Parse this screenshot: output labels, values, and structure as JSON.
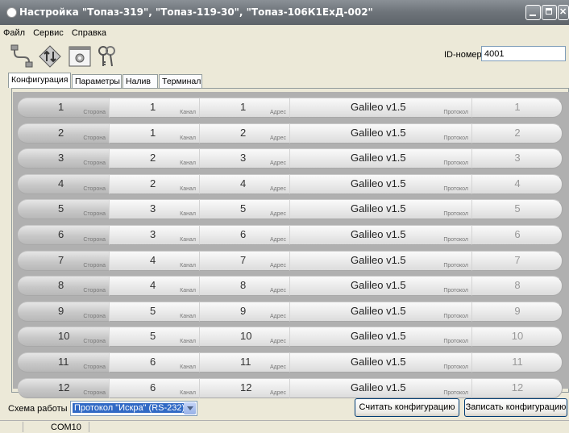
{
  "window": {
    "title": "Настройка \"Топаз-319\", \"Топаз-119-30\", \"Топаз-106К1ЕхД-002\""
  },
  "menu": {
    "items": [
      "Файл",
      "Сервис",
      "Справка"
    ]
  },
  "toolbar": {
    "icons": [
      "connect-cable-icon",
      "transfer-arrows-icon",
      "settings-icon",
      "keys-icon"
    ]
  },
  "id": {
    "label": "ID-номер",
    "value": "4001"
  },
  "tabs": [
    "Конфигурация",
    "Параметры",
    "Налив",
    "Терминал"
  ],
  "grid": {
    "sub_labels": {
      "side": "Сторона",
      "channel": "Канал",
      "address": "Адрес",
      "protocol": "Протокол"
    },
    "rows": [
      {
        "side": "1",
        "channel": "1",
        "address": "1",
        "protocol": "Galileo v1.5",
        "extra": "1"
      },
      {
        "side": "2",
        "channel": "1",
        "address": "2",
        "protocol": "Galileo v1.5",
        "extra": "2"
      },
      {
        "side": "3",
        "channel": "2",
        "address": "3",
        "protocol": "Galileo v1.5",
        "extra": "3"
      },
      {
        "side": "4",
        "channel": "2",
        "address": "4",
        "protocol": "Galileo v1.5",
        "extra": "4"
      },
      {
        "side": "5",
        "channel": "3",
        "address": "5",
        "protocol": "Galileo v1.5",
        "extra": "5"
      },
      {
        "side": "6",
        "channel": "3",
        "address": "6",
        "protocol": "Galileo v1.5",
        "extra": "6"
      },
      {
        "side": "7",
        "channel": "4",
        "address": "7",
        "protocol": "Galileo v1.5",
        "extra": "7"
      },
      {
        "side": "8",
        "channel": "4",
        "address": "8",
        "protocol": "Galileo v1.5",
        "extra": "8"
      },
      {
        "side": "9",
        "channel": "5",
        "address": "9",
        "protocol": "Galileo v1.5",
        "extra": "9"
      },
      {
        "side": "10",
        "channel": "5",
        "address": "10",
        "protocol": "Galileo v1.5",
        "extra": "10"
      },
      {
        "side": "11",
        "channel": "6",
        "address": "11",
        "protocol": "Galileo v1.5",
        "extra": "11"
      },
      {
        "side": "12",
        "channel": "6",
        "address": "12",
        "protocol": "Galileo v1.5",
        "extra": "12"
      }
    ]
  },
  "bottom": {
    "mode_label": "Схема работы",
    "mode_value": "Протокол \"Искра\" (RS-232)",
    "read_button": "Считать конфигурацию",
    "write_button": "Записать конфигурацию"
  },
  "status": {
    "port": "COM10"
  }
}
